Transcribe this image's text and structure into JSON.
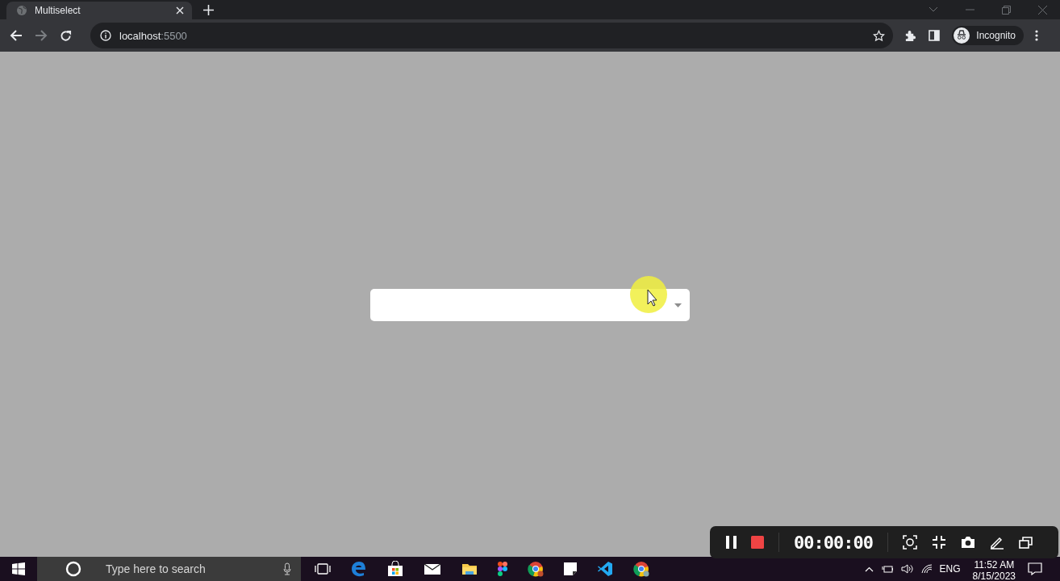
{
  "browser": {
    "tab": {
      "title": "Multiselect"
    },
    "address": {
      "host": "localhost",
      "port": ":5500"
    },
    "profile": "Incognito"
  },
  "taskbar": {
    "search": {
      "placeholder": "Type here to search"
    },
    "tray": {
      "language": "ENG",
      "time": "11:52 AM",
      "date": "8/15/2023"
    }
  },
  "recorder": {
    "timer": "00:00:00"
  }
}
